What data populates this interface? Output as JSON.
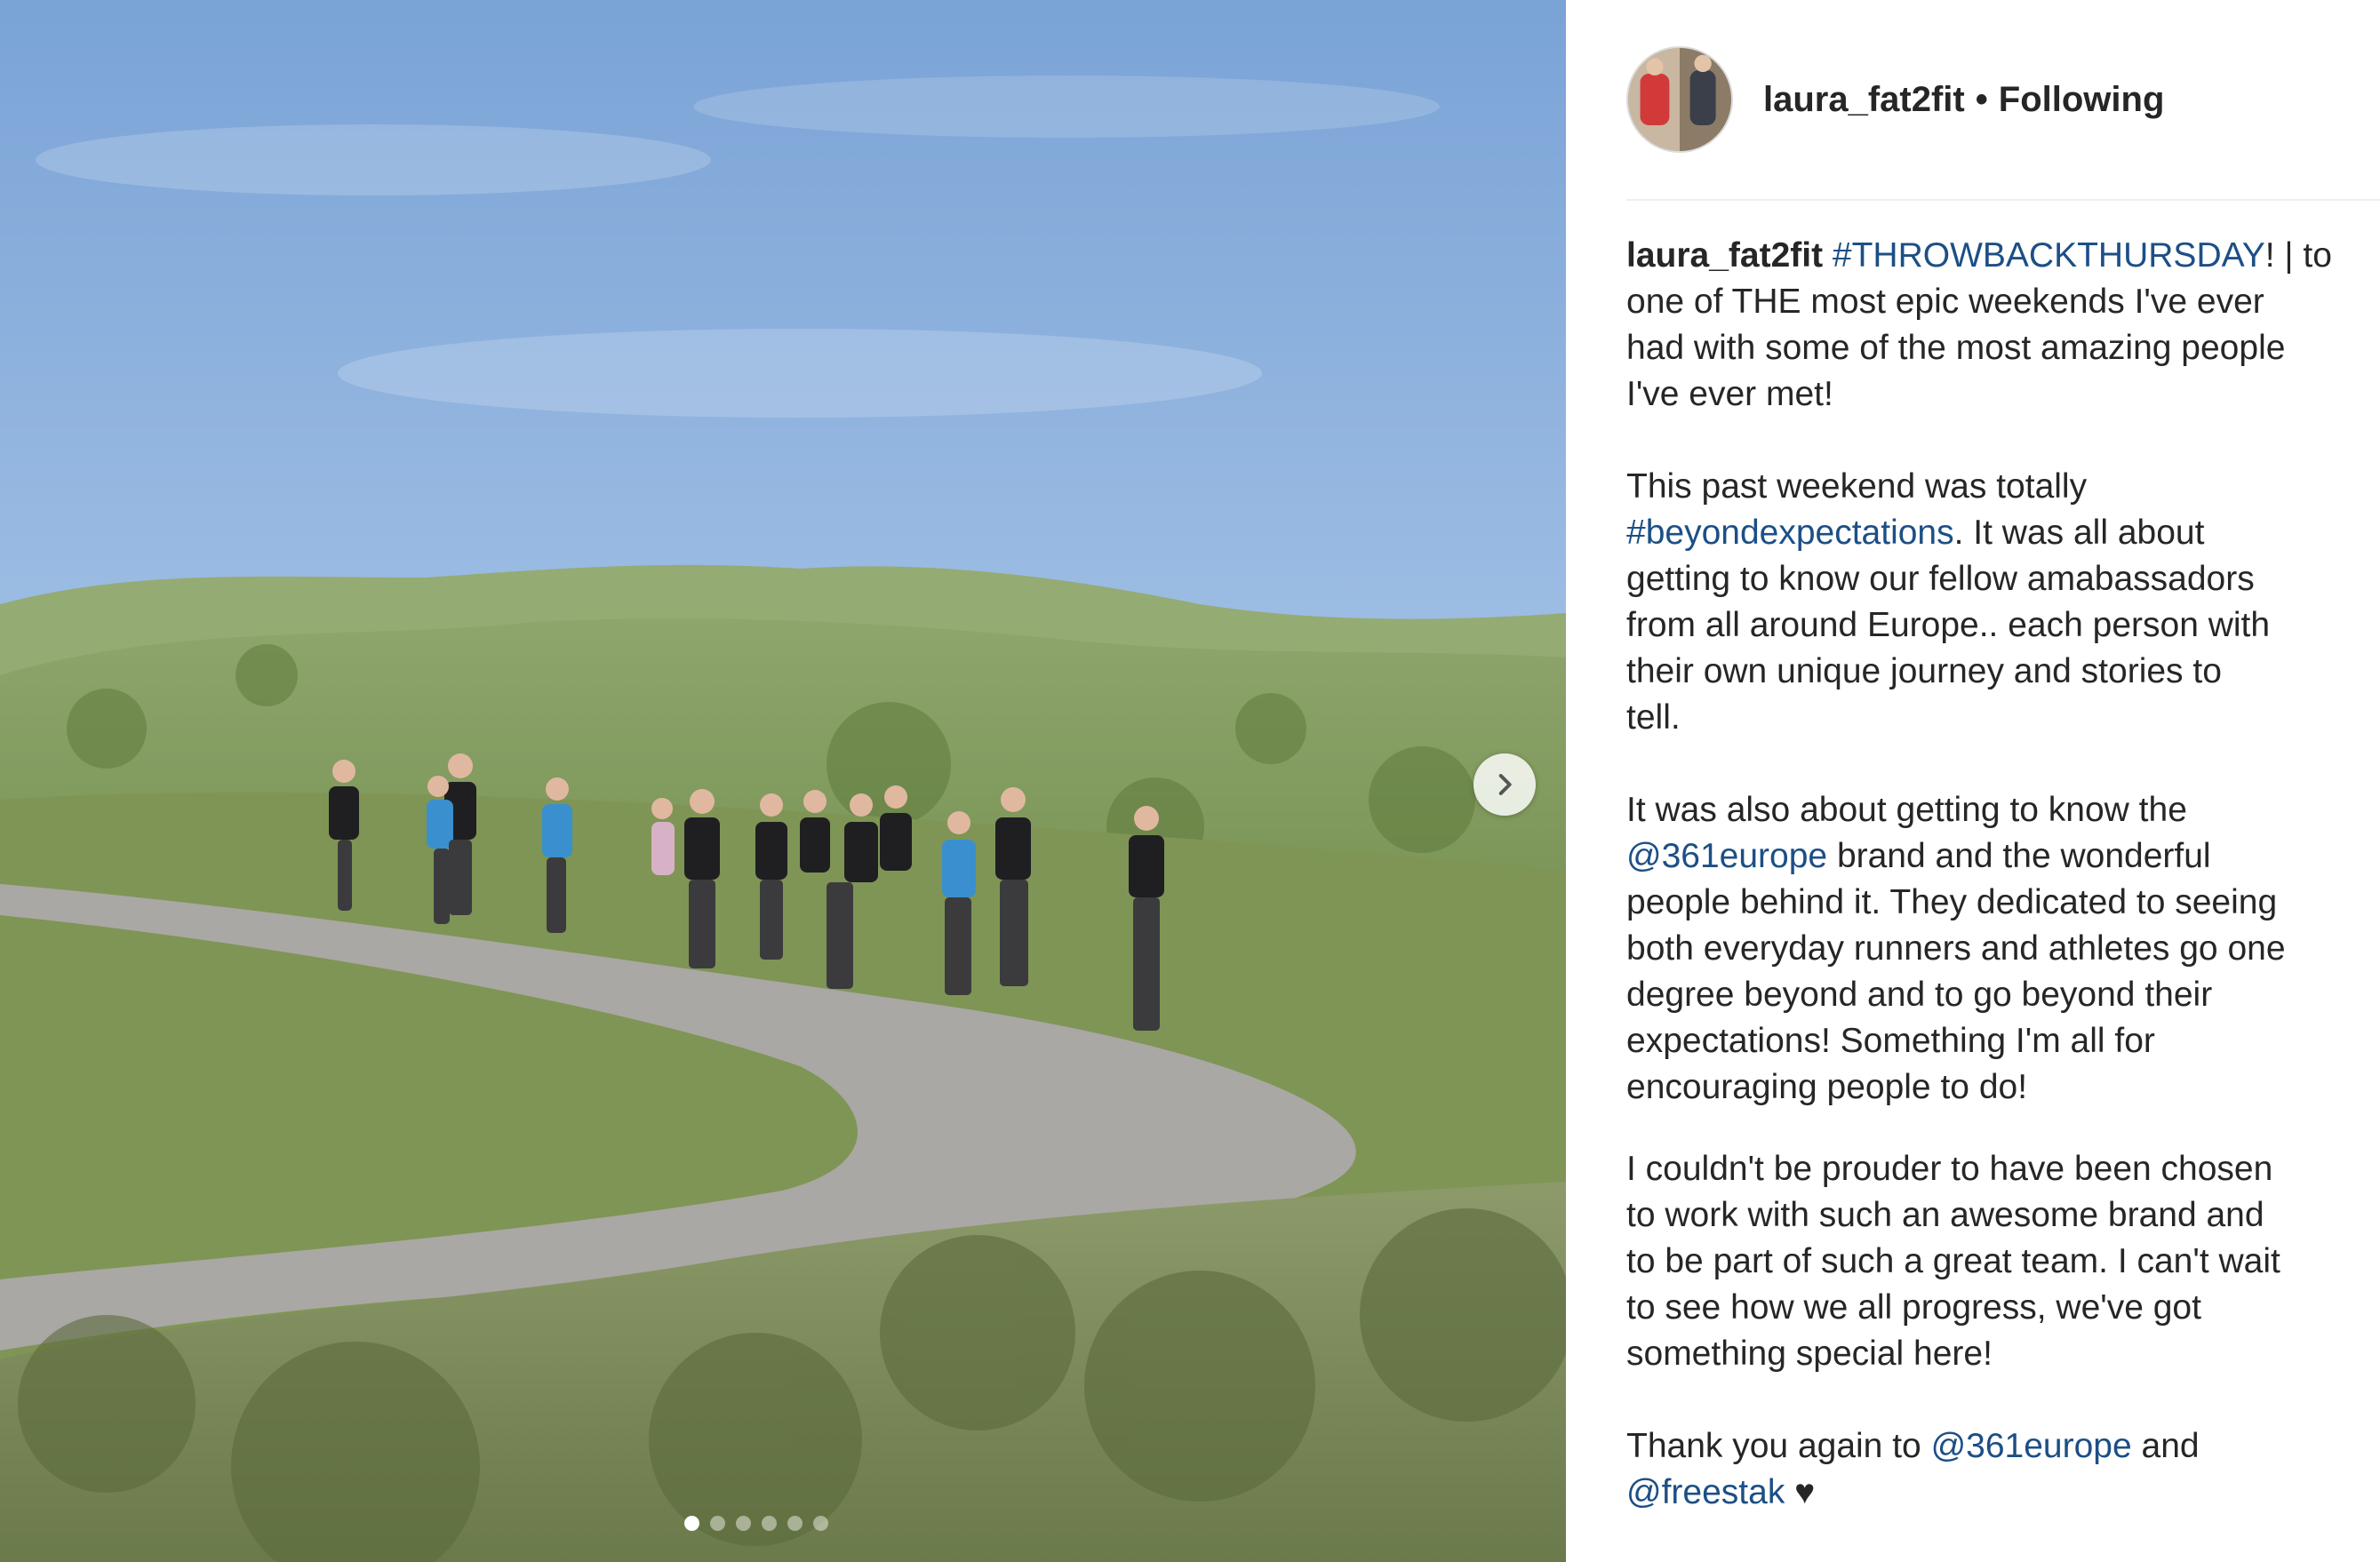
{
  "post": {
    "username": "laura_fat2fit",
    "separator": "•",
    "follow_status": "Following"
  },
  "caption": {
    "username": "laura_fat2fit",
    "p1": {
      "tag": "#THROWBACKTHURSDAY",
      "rest_line1": "! | to",
      "line2": "one of THE most epic weekends I've ever",
      "line3": "had with some of the most amazing people",
      "line4": "I've ever met!"
    },
    "p2": {
      "line1": "This past weekend was totally",
      "tag": "#beyondexpectations",
      "rest_line2": ". It was all about",
      "line3": "getting to know our fellow amabassadors",
      "line4": "from all around Europe.. each person with",
      "line5": "their own unique journey and stories to",
      "line6": "tell."
    },
    "p3": {
      "line1": "It was also about getting to know the",
      "mention": "@361europe",
      "rest_line2": " brand and the wonderful",
      "line3": "people behind it. They dedicated to seeing",
      "line4": "both everyday runners and athletes go one",
      "line5": "degree beyond and to go beyond their",
      "line6": "expectations! Something I'm all for",
      "line7": "encouraging people to do!"
    },
    "p4": {
      "line1": "I couldn't be prouder to have been chosen",
      "line2": "to work with such an awesome brand and",
      "line3": "to be part of such a great team. I can't wait",
      "line4": "to see how we all progress, we've got",
      "line5": "something special here!"
    },
    "p5": {
      "line1_start": "Thank you again to ",
      "mention1": "@361europe",
      "line1_end": " and",
      "mention2": "@freestak",
      "heart": " ♥"
    }
  },
  "carousel": {
    "slide_count": 6,
    "active_slide": 1,
    "next_icon": "chevron-right-icon"
  },
  "colors": {
    "link": "#1c4f86",
    "text": "#262626",
    "divider": "#efefef"
  }
}
